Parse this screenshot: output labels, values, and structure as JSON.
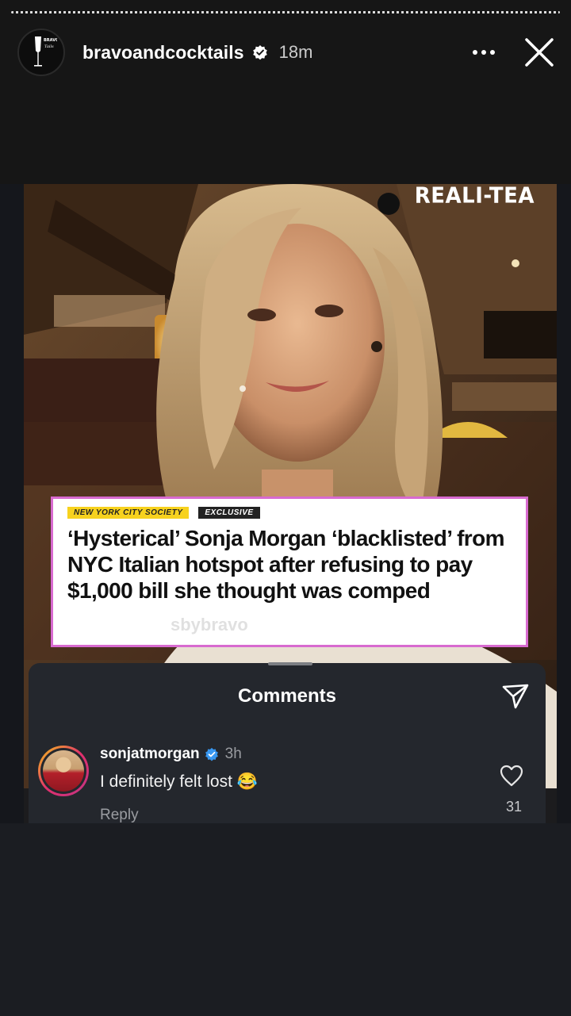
{
  "story": {
    "username": "bravoandcocktails",
    "time": "18m",
    "avatar_text": "BRAVO"
  },
  "post": {
    "brand": "REALI-TEA",
    "tags": [
      "NEW YORK CITY SOCIETY",
      "EXCLUSIVE"
    ],
    "headline": "‘Hysterical’ Sonja Morgan ‘blacklisted’ from NYC Italian hotspot after refusing to pay $1,000 bill she thought was comped",
    "watermark": "sbybravo"
  },
  "comments_sheet": {
    "title": "Comments",
    "items": [
      {
        "user": "sonjatmorgan",
        "time": "3h",
        "text": "I definitely felt lost 😂",
        "reply_label": "Reply",
        "likes": "31"
      }
    ]
  },
  "colors": {
    "accent_frame": "#d86ad0",
    "tag_yellow": "#f7d21e",
    "verified_blue": "#3897f0"
  }
}
